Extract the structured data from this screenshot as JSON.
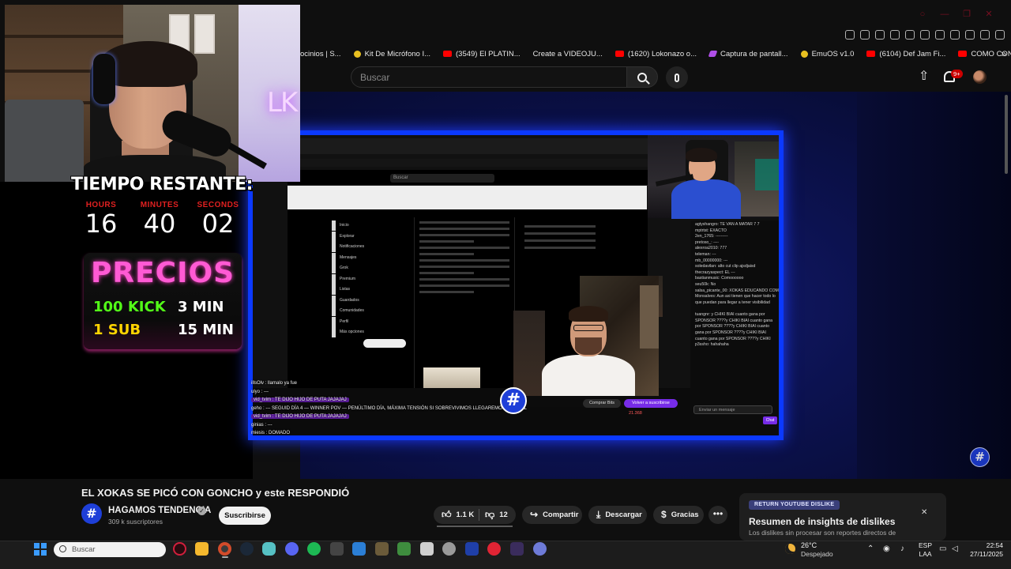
{
  "browser": {
    "bookmarks": [
      {
        "label": "ocinios | S...",
        "icon": "none"
      },
      {
        "label": "Kit De Micrófono I...",
        "icon": "yellow"
      },
      {
        "label": "(3549) El PLATIN...",
        "icon": "yt"
      },
      {
        "label": "Create a VIDEOJU...",
        "icon": "none"
      },
      {
        "label": "(1620) Lokonazo o...",
        "icon": "yt"
      },
      {
        "label": "Captura de pantall...",
        "icon": "purple"
      },
      {
        "label": "EmuOS v1.0",
        "icon": "yellow"
      },
      {
        "label": "(6104) Def Jam Fi...",
        "icon": "yt"
      },
      {
        "label": "COMO CONFIGUR...",
        "icon": "yt"
      }
    ],
    "more_label": "»"
  },
  "youtube_header": {
    "search_placeholder": "Buscar",
    "notifications_badge": "9+"
  },
  "stream_overlay": {
    "timer_title": "TIEMPO RESTANTE:",
    "timer": [
      {
        "label": "HOURS",
        "value": "16"
      },
      {
        "label": "MINUTES",
        "value": "40"
      },
      {
        "label": "SECONDS",
        "value": "02"
      }
    ],
    "prices_title": "PRECIOS",
    "prices": [
      {
        "item": "100 KICK",
        "time": "3 MIN"
      },
      {
        "item": "1 SUB",
        "time": "15 MIN"
      }
    ],
    "colors": {
      "accent_pink": "#ff5ad4",
      "kick_green": "#53fc18",
      "sub_yellow": "#ffd400",
      "frame_blue": "#0b39ff"
    }
  },
  "inner_stream": {
    "x_search": "Buscar",
    "x_nav": [
      "Inicio",
      "Explorar",
      "Notificaciones",
      "Mensajes",
      "Grok",
      "Premium",
      "Listas",
      "Guardados",
      "Comunidades",
      "Perfil",
      "Más opciones"
    ],
    "comprar_label": "Comprar Bits",
    "sub_label": "Volver a suscribirse",
    "viewers": "21.368",
    "chat_lines": [
      "agtyshangro: TE VAN A MATAR 7 7",
      "mptrtst: EXACTO",
      "2en_1765: ---------",
      "pretoso_: ----",
      "alexroa2010: 777",
      "teleman: ---",
      "mb_00000000: ---",
      "soledavilan: alto cut clip ajsdjaisd",
      "thecrazyaspect: EL ---",
      "bastianmusic: Comoooooo",
      "seu50k: No",
      "salsa_picante_00: XOKAS EDUCANDO COMO SIEMPRE",
      "Monsalves: Aun asi tienen que hacer todo lo que puedan para llegar a tener visibilidad",
      "tuangnr: y CHIKI BIAI cuanto gana por SPONSOR ????y CHIKI BIAI cuanto gana por SPONSOR ????y CHIKI BIAI cuanto gana por SPONSOR ????y CHIKI BIAI cuanto gana por SPONSOR ????y CHIKI BIAI cuanto gana por SPONSOR ???",
      "p3ssho: hahahaha"
    ],
    "chat_placeholder": "Enviar un mensaje",
    "chat_send": "Chat",
    "overlay_chat": [
      "illsOlv : llamalo ya fue",
      "ulyo : ---",
      "vid_tvim : TE DIJO HIJO DE PUTA JAJAJAJ",
      "geho : --- SEGUID DÍA 4 — WINNER POV — PENÚLTIMO DÍA, MÁXIMA TENSIÓN SI SOBREVIVIMOS LLEGAREMOS AL FINAL",
      "vid_tvim : TE DIJO HIJO DE PUTA JAJAJAJ",
      "ginias : ---",
      "miesis : DOMADO"
    ]
  },
  "video": {
    "title": "EL XOKAS SE PICÓ CON GONCHO y este RESPONDIÓ",
    "channel_name": "HAGAMOS TENDENCIA",
    "channel_subs": "309 k suscriptores",
    "subscribe_label": "Suscribirse",
    "likes": "1.1 K",
    "dislikes": "12",
    "share_label": "Compartir",
    "download_label": "Descargar",
    "thanks_label": "Gracias",
    "more_label": "•••"
  },
  "return_dislike": {
    "badge": "RETURN YOUTUBE DISLIKE",
    "title": "Resumen de insights de dislikes",
    "subtitle": "Los dislikes sin procesar son reportes directos de"
  },
  "taskbar": {
    "search_placeholder": "Buscar",
    "weather_temp": "26°C",
    "weather_desc": "Despejado",
    "lang_line1": "ESP",
    "lang_line2": "LAA",
    "time": "22:54",
    "date": "27/11/2025"
  }
}
